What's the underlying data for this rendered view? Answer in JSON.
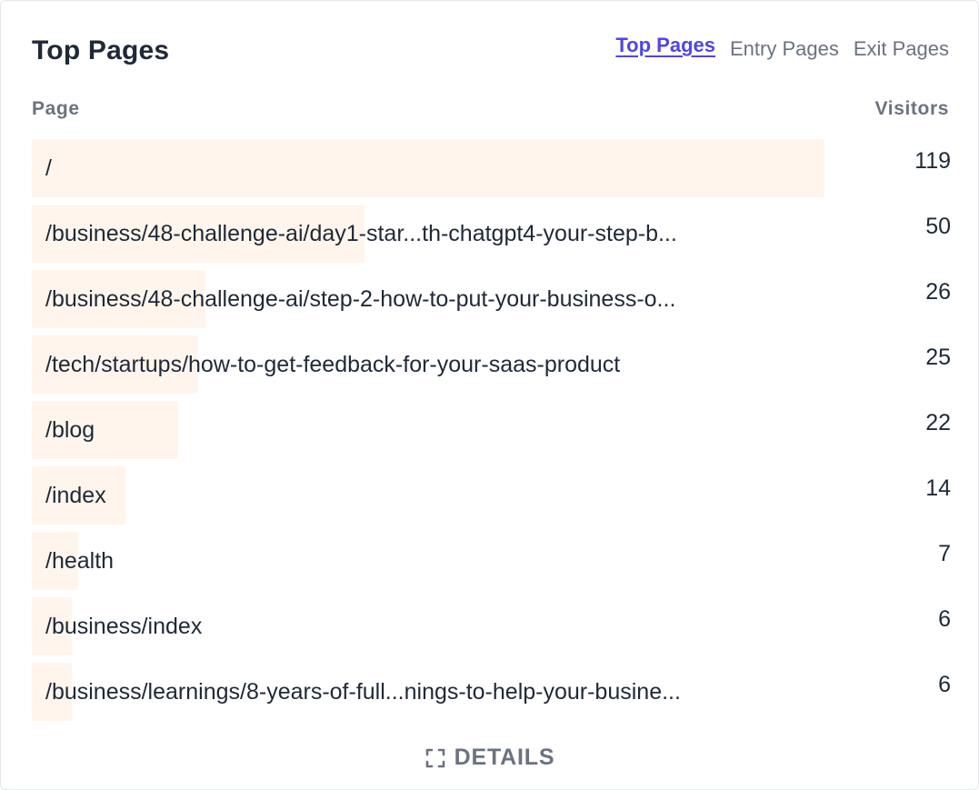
{
  "card": {
    "title": "Top Pages"
  },
  "tabs": [
    {
      "label": "Top Pages",
      "active": true
    },
    {
      "label": "Entry Pages",
      "active": false
    },
    {
      "label": "Exit Pages",
      "active": false
    }
  ],
  "columns": {
    "page": "Page",
    "visitors": "Visitors"
  },
  "max_visitors": 119,
  "bar_color": "#fff5ec",
  "accent_color": "#4f46e5",
  "rows": [
    {
      "label": "/",
      "visitors": "119",
      "value": 119
    },
    {
      "label": "/business/48-challenge-ai/day1-star...th-chatgpt4-your-step-b...",
      "visitors": "50",
      "value": 50
    },
    {
      "label": "/business/48-challenge-ai/step-2-how-to-put-your-business-o...",
      "visitors": "26",
      "value": 26
    },
    {
      "label": "/tech/startups/how-to-get-feedback-for-your-saas-product",
      "visitors": "25",
      "value": 25
    },
    {
      "label": "/blog",
      "visitors": "22",
      "value": 22
    },
    {
      "label": "/index",
      "visitors": "14",
      "value": 14
    },
    {
      "label": "/health",
      "visitors": "7",
      "value": 7
    },
    {
      "label": "/business/index",
      "visitors": "6",
      "value": 6
    },
    {
      "label": "/business/learnings/8-years-of-full...nings-to-help-your-busine...",
      "visitors": "6",
      "value": 6
    }
  ],
  "footer": {
    "details_label": "DETAILS",
    "details_icon": "expand-icon"
  }
}
